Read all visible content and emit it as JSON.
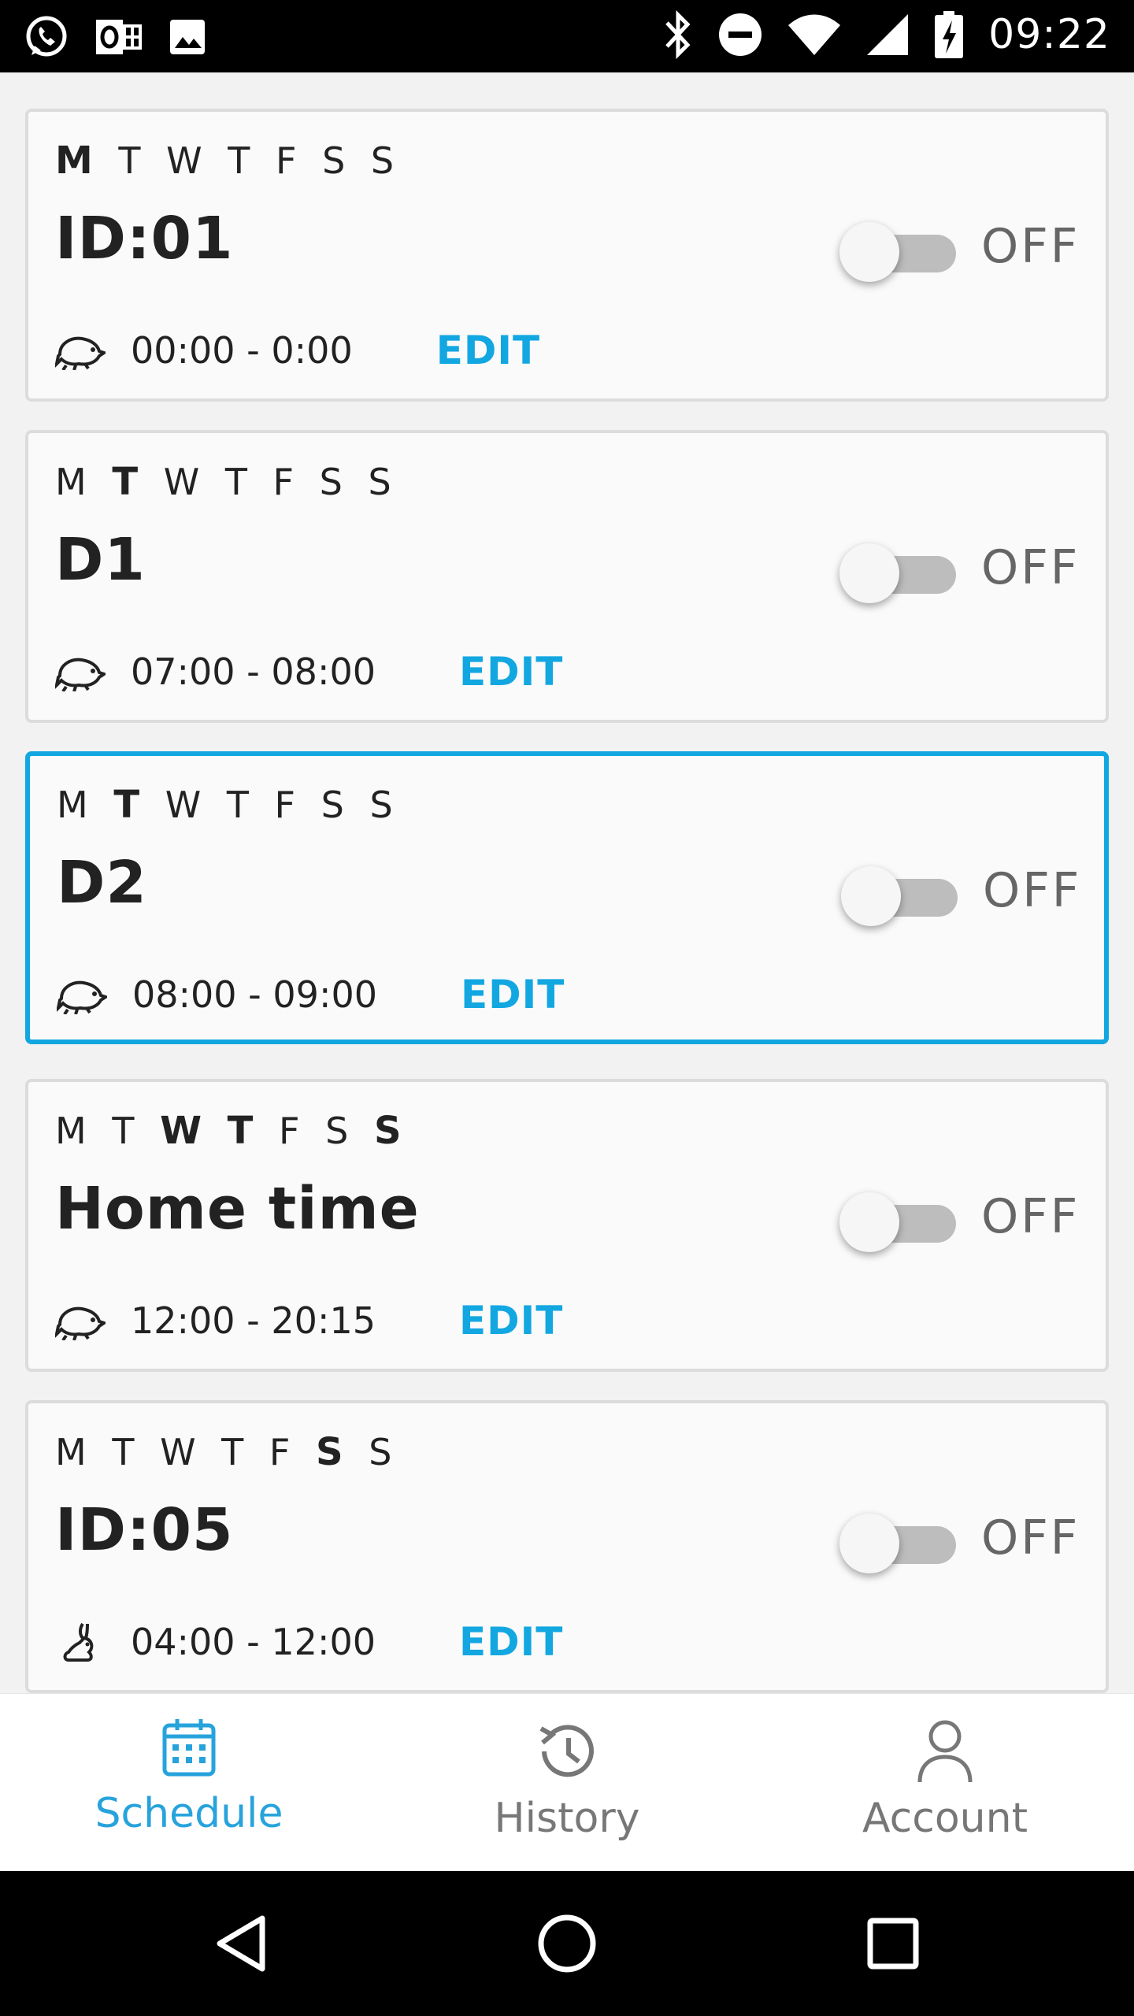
{
  "status_bar": {
    "time": "09:22",
    "left_icons": [
      "whatsapp-icon",
      "outlook-icon",
      "gallery-icon"
    ],
    "right_icons": [
      "bluetooth-icon",
      "do-not-disturb-icon",
      "wifi-icon",
      "signal-icon",
      "battery-charging-icon"
    ]
  },
  "schedules": [
    {
      "days": [
        {
          "label": "M",
          "active": true
        },
        {
          "label": "T",
          "active": false
        },
        {
          "label": "W",
          "active": false
        },
        {
          "label": "T",
          "active": false
        },
        {
          "label": "F",
          "active": false
        },
        {
          "label": "S",
          "active": false
        },
        {
          "label": "S",
          "active": false
        }
      ],
      "name": "ID:01",
      "state": "OFF",
      "time": "00:00 - 0:00",
      "edit_label": "EDIT",
      "icon": "running-hamster-icon"
    },
    {
      "days": [
        {
          "label": "M",
          "active": false
        },
        {
          "label": "T",
          "active": true
        },
        {
          "label": "W",
          "active": false
        },
        {
          "label": "T",
          "active": false
        },
        {
          "label": "F",
          "active": false
        },
        {
          "label": "S",
          "active": false
        },
        {
          "label": "S",
          "active": false
        }
      ],
      "name": "D1",
      "state": "OFF",
      "time": "07:00 - 08:00",
      "edit_label": "EDIT",
      "icon": "running-hamster-icon"
    },
    {
      "days": [
        {
          "label": "M",
          "active": false
        },
        {
          "label": "T",
          "active": true
        },
        {
          "label": "W",
          "active": false
        },
        {
          "label": "T",
          "active": false
        },
        {
          "label": "F",
          "active": false
        },
        {
          "label": "S",
          "active": false
        },
        {
          "label": "S",
          "active": false
        }
      ],
      "name": "D2",
      "state": "OFF",
      "time": "08:00 - 09:00",
      "edit_label": "EDIT",
      "icon": "running-hamster-icon",
      "selected": true
    },
    {
      "days": [
        {
          "label": "M",
          "active": false
        },
        {
          "label": "T",
          "active": false
        },
        {
          "label": "W",
          "active": true
        },
        {
          "label": "T",
          "active": true
        },
        {
          "label": "F",
          "active": false
        },
        {
          "label": "S",
          "active": false
        },
        {
          "label": "S",
          "active": true
        }
      ],
      "name": "Home time",
      "state": "OFF",
      "time": "12:00 - 20:15",
      "edit_label": "EDIT",
      "icon": "running-hamster-icon"
    },
    {
      "days": [
        {
          "label": "M",
          "active": false
        },
        {
          "label": "T",
          "active": false
        },
        {
          "label": "W",
          "active": false
        },
        {
          "label": "T",
          "active": false
        },
        {
          "label": "F",
          "active": false
        },
        {
          "label": "S",
          "active": true
        },
        {
          "label": "S",
          "active": false
        }
      ],
      "name": "ID:05",
      "state": "OFF",
      "time": "04:00 - 12:00",
      "edit_label": "EDIT",
      "icon": "sitting-rabbit-icon"
    }
  ],
  "bottom_nav": [
    {
      "label": "Schedule",
      "icon": "calendar-icon",
      "active": true
    },
    {
      "label": "History",
      "icon": "history-icon",
      "active": false
    },
    {
      "label": "Account",
      "icon": "account-icon",
      "active": false
    }
  ],
  "colors": {
    "accent": "#12a7e1",
    "nav_active": "#27a3dc",
    "nav_inactive": "#777777",
    "toggle_track": "#bdbdbd"
  }
}
